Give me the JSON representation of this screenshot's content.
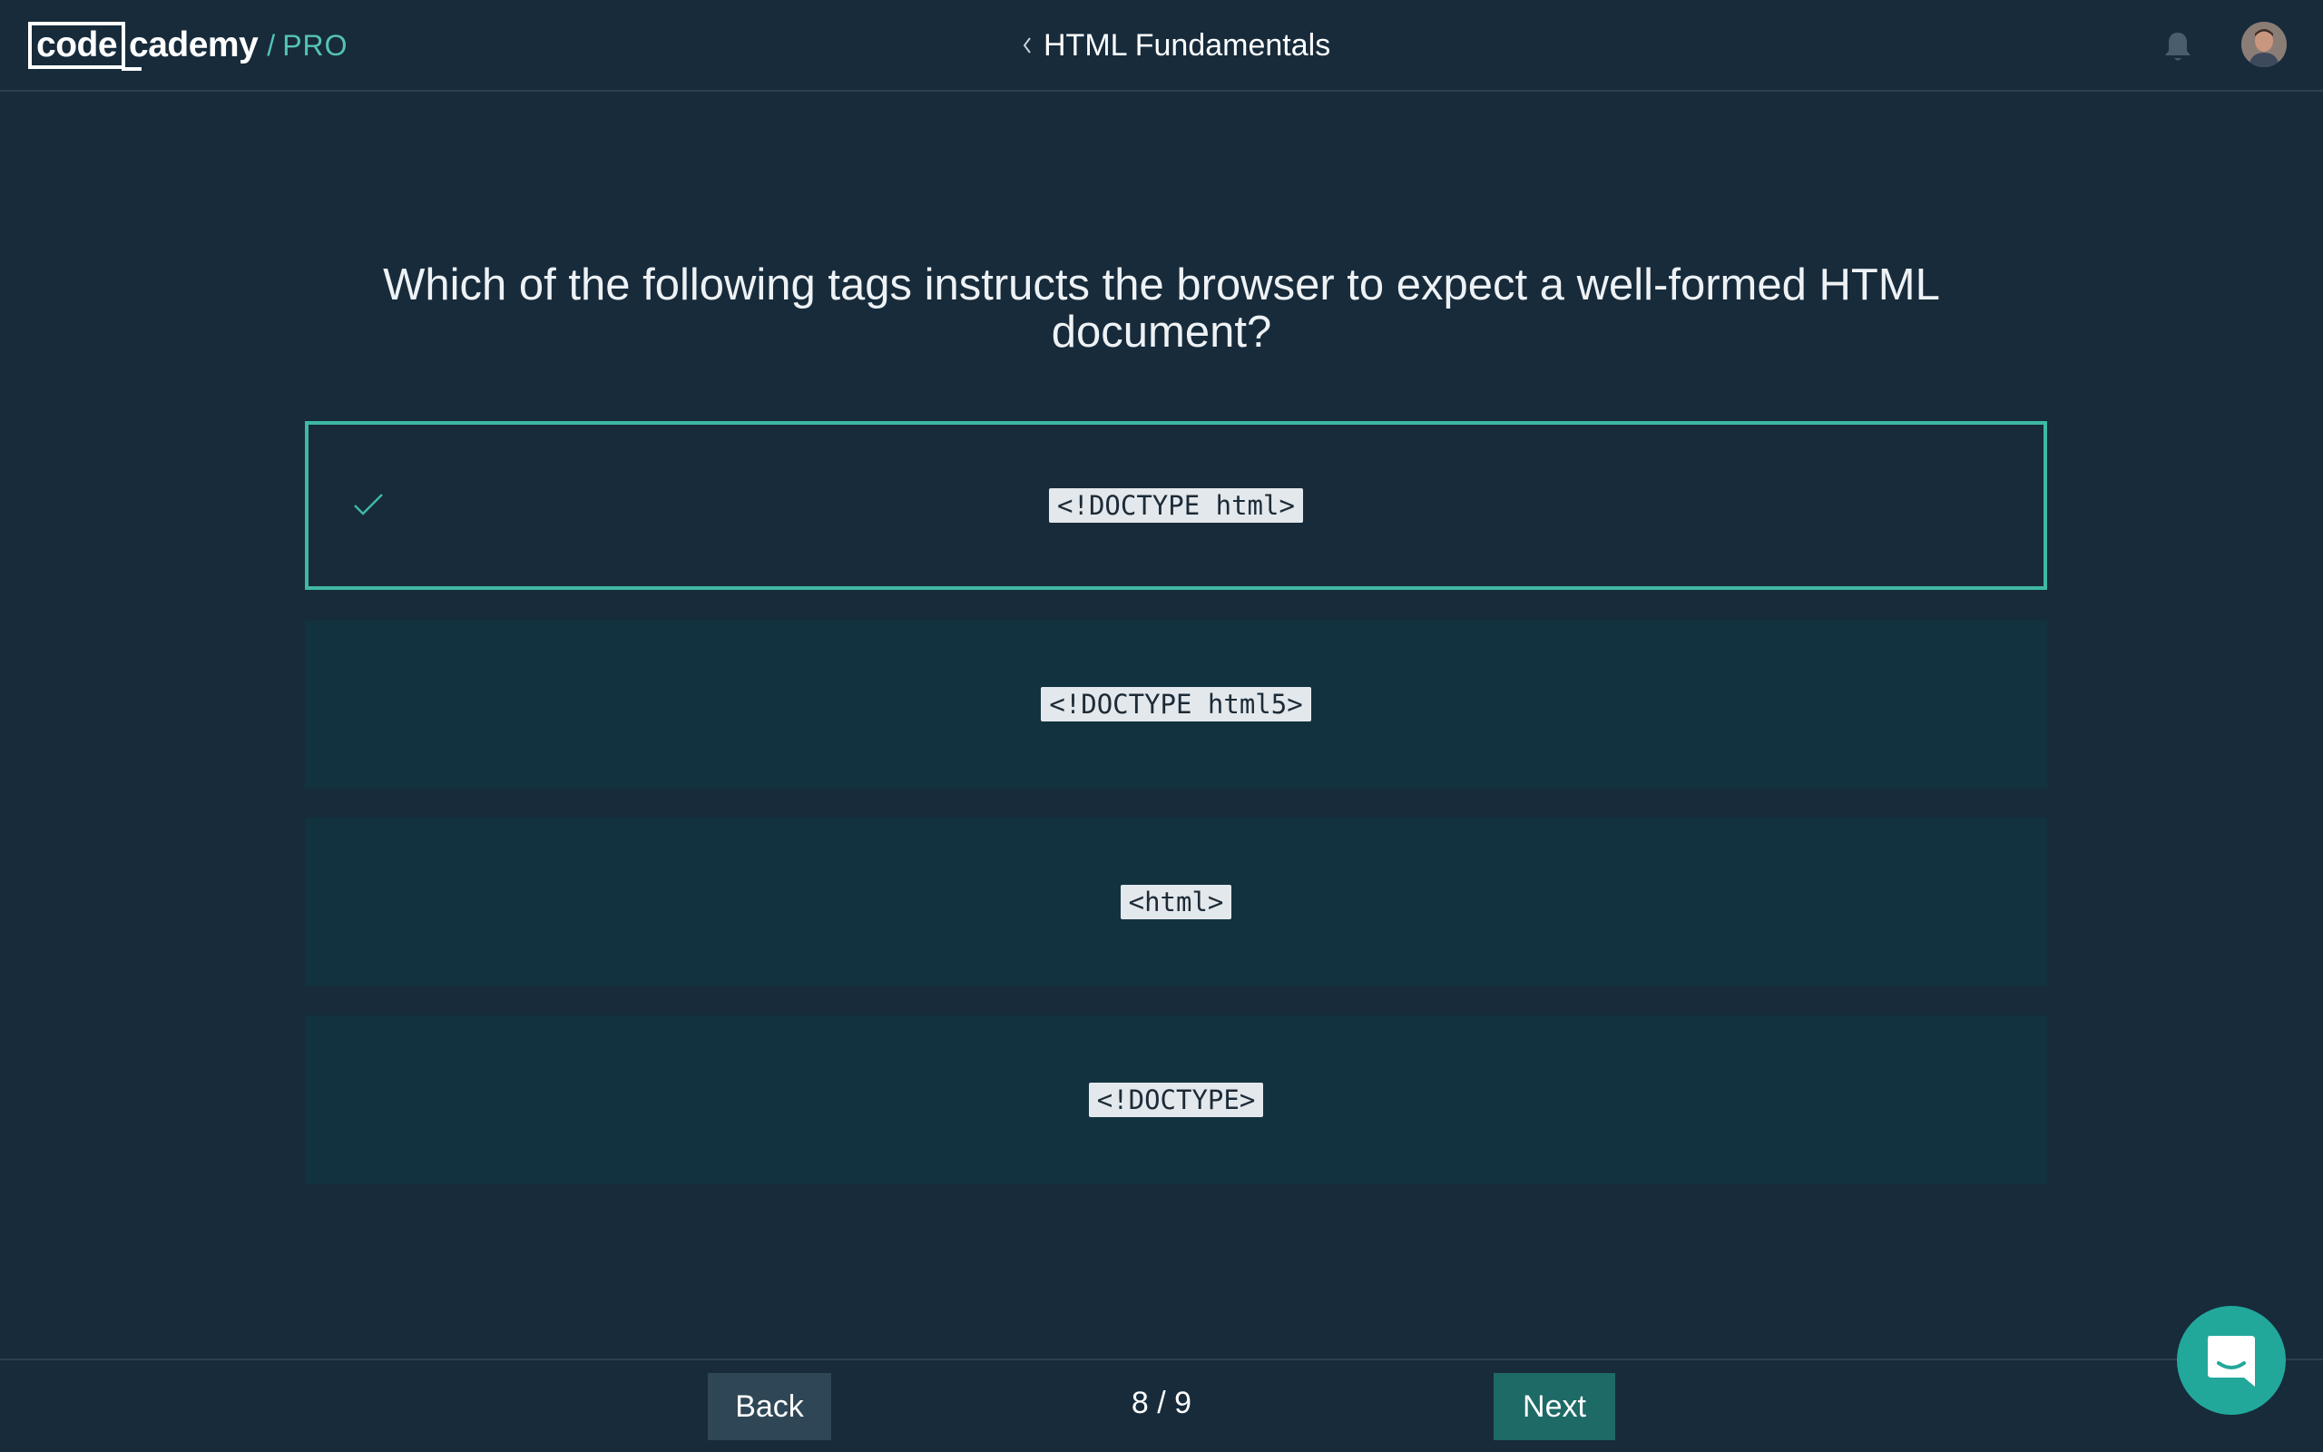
{
  "app": {
    "brand_box": "code",
    "brand_rest": "cademy",
    "brand_sep": "/",
    "brand_tier": "PRO"
  },
  "header": {
    "course_title": "HTML Fundamentals",
    "icons": [
      "chevron-left-icon",
      "bell-icon",
      "avatar"
    ]
  },
  "quiz": {
    "question": "Which of the following tags instructs the browser to expect a well-formed HTML document?",
    "options": [
      {
        "label": "<!DOCTYPE html>",
        "selected": true
      },
      {
        "label": "<!DOCTYPE html5>",
        "selected": false
      },
      {
        "label": "<html>",
        "selected": false
      },
      {
        "label": "<!DOCTYPE>",
        "selected": false
      }
    ]
  },
  "footer": {
    "back_label": "Back",
    "progress": "8 / 9",
    "next_label": "Next"
  },
  "colors": {
    "background": "#172b3b",
    "option_bg": "#12323f",
    "accent": "#3fb8a4",
    "next_button": "#1d6a66",
    "back_button": "#2f4656",
    "chat_bubble": "#22a89a"
  }
}
